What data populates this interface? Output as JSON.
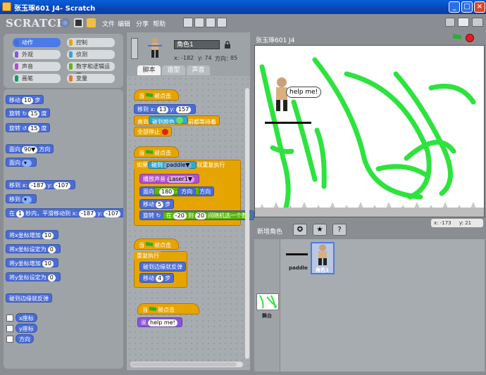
{
  "window": {
    "title": "张玉琢601 J4- Scratch"
  },
  "menubar": {
    "logo": "SCRATCH",
    "items": [
      "文件",
      "编辑",
      "分享",
      "帮助"
    ]
  },
  "categories": [
    {
      "label": "动作",
      "color": "#4a6cd4",
      "selected": true
    },
    {
      "label": "控制",
      "color": "#e6a400"
    },
    {
      "label": "外观",
      "color": "#8a55d7"
    },
    {
      "label": "侦测",
      "color": "#2ea8d8"
    },
    {
      "label": "声音",
      "color": "#b050c8"
    },
    {
      "label": "数字和逻辑运算",
      "color": "#5cb712"
    },
    {
      "label": "画笔",
      "color": "#0e9a6c"
    },
    {
      "label": "变量",
      "color": "#f07818"
    }
  ],
  "palette": {
    "move": "移动",
    "move_steps": "10",
    "move_unit": "步",
    "turn_cw": "旋转",
    "turn_cw_val": "15",
    "turn_unit": "度",
    "turn_ccw": "旋转",
    "turn_ccw_val": "15",
    "point_dir": "面向",
    "point_dir_val": "90▼",
    "point_dir_unit": "方向",
    "point_towards": "面向",
    "goto_xy": "移到 x:",
    "goto_x": "-187",
    "goto_y_label": "y:",
    "goto_y": "-107",
    "goto": "移到",
    "glide_a": "在",
    "glide_secs": "1",
    "glide_b": "秒内，平滑移动到 x:",
    "glide_x": "-187",
    "glide_y_label": "y:",
    "glide_y": "-107",
    "change_x": "将x坐标增加",
    "change_x_val": "10",
    "set_x": "将x坐标设定为",
    "set_x_val": "0",
    "change_y": "将y坐标增加",
    "change_y_val": "10",
    "set_y": "将y坐标设定为",
    "set_y_val": "0",
    "bounce": "碰到边缘就反弹",
    "rep_x": "x座标",
    "rep_y": "y座标",
    "rep_dir": "方向"
  },
  "sprite": {
    "name": "角色1",
    "x_label": "x: -182",
    "y_label": "y: 74",
    "dir_label": "方向：",
    "dir": "85"
  },
  "tabs": [
    {
      "label": "脚本",
      "selected": true
    },
    {
      "label": "造型"
    },
    {
      "label": "声音"
    }
  ],
  "scripts": {
    "s1_hat": "当",
    "s1_hat2": "被点击",
    "s1_goto": "移到 x:",
    "s1_x": "13",
    "s1_y_label": "y:",
    "s1_y": "157",
    "s1_wait": "直到",
    "s1_touching": "碰到颜色",
    "s1_wait2": "前都等待着",
    "s1_stop": "全部停止",
    "s2_hat": "当",
    "s2_hat2": "被点击",
    "s2_if": "如果",
    "s2_touch": "碰到",
    "s2_target": "paddle▼",
    "s2_forever": "就重复执行",
    "s2_sound": "播放声音",
    "s2_sound_val": "Laser1▼",
    "s2_point": "面向",
    "s2_point_val": "180",
    "s2_minus": "-",
    "s2_dir": "方向",
    "s2_dir2": "方向",
    "s2_move": "移动",
    "s2_move_val": "5",
    "s2_move_unit": "步",
    "s2_turn": "旋转",
    "s2_rand_a": "在",
    "s2_rand_min": "-20",
    "s2_rand_b": "到",
    "s2_rand_max": "20",
    "s2_rand_c": "间随机选一个数",
    "s3_hat": "当",
    "s3_hat2": "被点击",
    "s3_forever": "重复执行",
    "s3_bounce": "碰到边缘就反弹",
    "s3_move": "移动",
    "s3_move_val": "4",
    "s3_move_unit": "步",
    "s4_hat": "当",
    "s4_hat2": "被点击",
    "s4_say": "说",
    "s4_say_val": "help me!"
  },
  "stage": {
    "title": "张玉琢601 J4",
    "speech": "help me!",
    "coords_x": "x: -173",
    "coords_y": "y: 21"
  },
  "spritelist": {
    "new_sprite": "新增角色",
    "paddle": "paddle",
    "sprite1": "角色1",
    "stage_label": "舞台"
  },
  "colors": {
    "vine": "#2de33d",
    "spikes": "#c8c8c8"
  }
}
